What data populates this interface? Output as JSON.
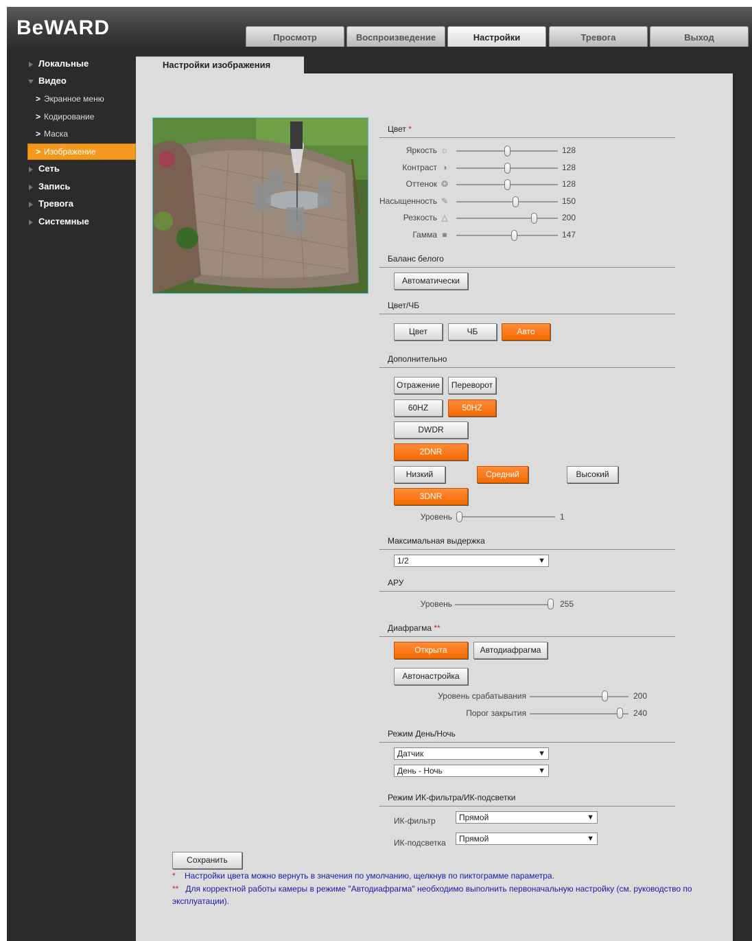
{
  "logo": "BeWARD",
  "tabs": [
    "Просмотр",
    "Воспроизведение",
    "Настройки",
    "Тревога",
    "Выход"
  ],
  "sidebar": {
    "local": "Локальные",
    "video": "Видео",
    "sub": [
      "Экранное меню",
      "Кодирование",
      "Маска",
      "Изображение"
    ],
    "network": "Сеть",
    "record": "Запись",
    "alarm": "Тревога",
    "system": "Системные"
  },
  "page_title": "Настройки изображения",
  "color": {
    "title": "Цвет",
    "sliders": [
      {
        "label": "Яркость",
        "icon": "sun-icon",
        "value": "128",
        "fraction": 0.5
      },
      {
        "label": "Контраст",
        "icon": "contrast-icon",
        "value": "128",
        "fraction": 0.5
      },
      {
        "label": "Оттенок",
        "icon": "hue-palette-icon",
        "value": "128",
        "fraction": 0.5
      },
      {
        "label": "Насыщенность",
        "icon": "saturation-icon",
        "value": "150",
        "fraction": 0.588
      },
      {
        "label": "Резкость",
        "icon": "sharpness-icon",
        "value": "200",
        "fraction": 0.784
      },
      {
        "label": "Гамма",
        "icon": "gamma-icon",
        "value": "147",
        "fraction": 0.576
      }
    ]
  },
  "white_balance": {
    "title": "Баланс белого",
    "button": "Автоматически"
  },
  "color_bw": {
    "title": "Цвет/ЧБ",
    "color": "Цвет",
    "bw": "ЧБ",
    "auto": "Авто"
  },
  "extra": {
    "title": "Дополнительно",
    "mirror": "Отражение",
    "flip": "Переворот",
    "hz60": "60HZ",
    "hz50": "50HZ",
    "dwdr": "DWDR",
    "dnr2": "2DNR",
    "low": "Низкий",
    "mid": "Средний",
    "high": "Высокий",
    "dnr3": "3DNR",
    "level_label": "Уровень",
    "level_value": "1",
    "level_fraction": 0.0
  },
  "shutter": {
    "title": "Максимальная выдержка",
    "value": "1/2"
  },
  "agc": {
    "title": "АРУ",
    "level_label": "Уровень",
    "level_value": "255",
    "level_fraction": 1.0
  },
  "iris": {
    "title": "Диафрагма",
    "open": "Открыта",
    "auto": "Автодиафрагма",
    "autoset": "Автонастройка",
    "trigger_label": "Уровень срабатывания",
    "trigger_value": "200",
    "trigger_fraction": 0.78,
    "close_label": "Порог закрытия",
    "close_value": "240",
    "close_fraction": 0.94
  },
  "daynight": {
    "title": "Режим День/Ночь",
    "mode": "Датчик",
    "type": "День - Ночь"
  },
  "ir": {
    "title": "Режим ИК-фильтра/ИК-подсветки",
    "filter_label": "ИК-фильтр",
    "filter_value": "Прямой",
    "light_label": "ИК-подсветка",
    "light_value": "Прямой"
  },
  "save": "Сохранить",
  "notes": {
    "star1": "*",
    "note1": "Настройки цвета можно вернуть в значения по умолчанию, щелкнув по пиктограмме параметра.",
    "star2": "**",
    "note2a": "Для корректной работы камеры в режиме \"Автодиафрагма\" необходимо выполнить первоначальную настройку (см. руководство по",
    "note2b": "эксплуатации)."
  },
  "colors": {
    "accent": "#f56b00",
    "nav_active": "#f39a1e",
    "note": "#1a1aa8"
  }
}
